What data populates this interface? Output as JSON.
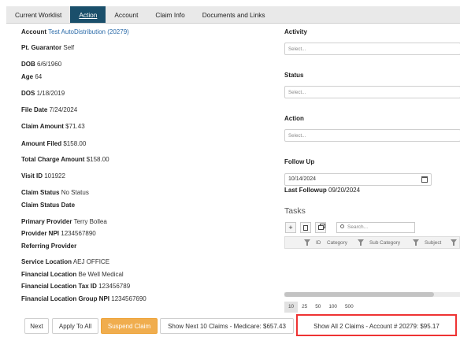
{
  "tabs": [
    {
      "label": "Current Worklist"
    },
    {
      "label": "Action"
    },
    {
      "label": "Account"
    },
    {
      "label": "Claim Info"
    },
    {
      "label": "Documents and Links"
    }
  ],
  "active_tab": "Action",
  "fields": {
    "account": {
      "label": "Account",
      "value": "Test AutoDistribution (20279)"
    },
    "guarantor": {
      "label": "Pt. Guarantor",
      "value": "Self"
    },
    "dob": {
      "label": "DOB",
      "value": "6/6/1960"
    },
    "age": {
      "label": "Age",
      "value": "64"
    },
    "dos": {
      "label": "DOS",
      "value": "1/18/2019"
    },
    "file_date": {
      "label": "File Date",
      "value": "7/24/2024"
    },
    "claim_amount": {
      "label": "Claim Amount",
      "value": "$71.43"
    },
    "amount_filed": {
      "label": "Amount Filed",
      "value": "$158.00"
    },
    "total_charge": {
      "label": "Total Charge Amount",
      "value": "$158.00"
    },
    "visit_id": {
      "label": "Visit ID",
      "value": "101922"
    },
    "claim_status": {
      "label": "Claim Status",
      "value": "No Status"
    },
    "claim_status_date": {
      "label": "Claim Status Date",
      "value": ""
    },
    "primary_provider": {
      "label": "Primary Provider",
      "value": "Terry Bollea"
    },
    "provider_npi": {
      "label": "Provider NPI",
      "value": "1234567890"
    },
    "referring_provider": {
      "label": "Referring Provider",
      "value": ""
    },
    "service_location": {
      "label": "Service Location",
      "value": "AEJ OFFICE"
    },
    "financial_location": {
      "label": "Financial Location",
      "value": "Be Well Medical"
    },
    "fin_tax_id": {
      "label": "Financial Location Tax ID",
      "value": "123456789"
    },
    "fin_group_npi": {
      "label": "Financial Location Group NPI",
      "value": "1234567690"
    }
  },
  "right": {
    "activity_label": "Activity",
    "activity_placeholder": "Select...",
    "status_label": "Status",
    "status_placeholder": "Select...",
    "action_label": "Action",
    "action_placeholder": "Select...",
    "followup_label": "Follow Up",
    "followup_value": "10/14/2024",
    "last_followup_label": "Last Followup",
    "last_followup_value": "09/20/2024"
  },
  "tasks": {
    "title": "Tasks",
    "search_placeholder": "Search...",
    "columns": [
      "ID",
      "Category",
      "Sub Category",
      "Subject"
    ],
    "page_sizes": [
      "10",
      "25",
      "50",
      "100",
      "500"
    ],
    "selected_page_size": "10"
  },
  "buttons": {
    "next": "Next",
    "apply_to_all": "Apply To All",
    "suspend_claim": "Suspend Claim",
    "show_next": "Show Next 10 Claims - Medicare: $657.43",
    "show_all": "Show All 2 Claims - Account # 20279: $95.17"
  },
  "colors": {
    "active_tab_bg": "#1a4f6b",
    "suspend_button": "#f0ad4e",
    "highlight_box": "#e33333",
    "link": "#2a6aa8"
  }
}
